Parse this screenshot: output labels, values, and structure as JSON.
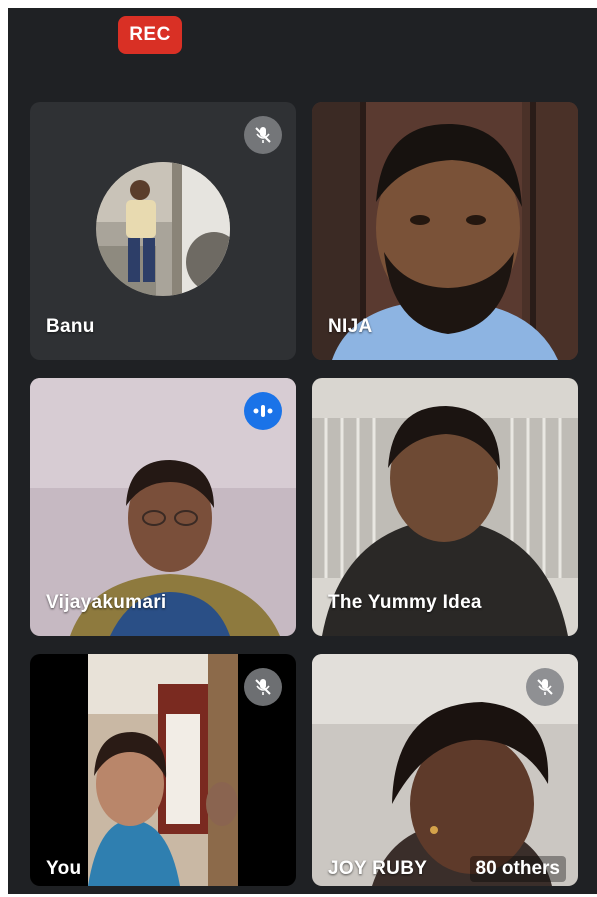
{
  "recording_badge": "REC",
  "participants": [
    {
      "name": "Banu",
      "status": "muted"
    },
    {
      "name": "NIJA",
      "status": "video"
    },
    {
      "name": "Vijayakumari",
      "status": "speaking"
    },
    {
      "name": "The Yummy Idea",
      "status": "video"
    },
    {
      "name": "You",
      "status": "muted"
    },
    {
      "name": "JOY RUBY",
      "status": "muted"
    }
  ],
  "others_count": "80 others",
  "colors": {
    "background": "#1f2124",
    "tile": "#2f3134",
    "rec_badge": "#d93025",
    "speaking_indicator": "#1a73e8"
  },
  "icons": {
    "muted": "mic-off-icon",
    "speaking": "audio-level-icon"
  }
}
